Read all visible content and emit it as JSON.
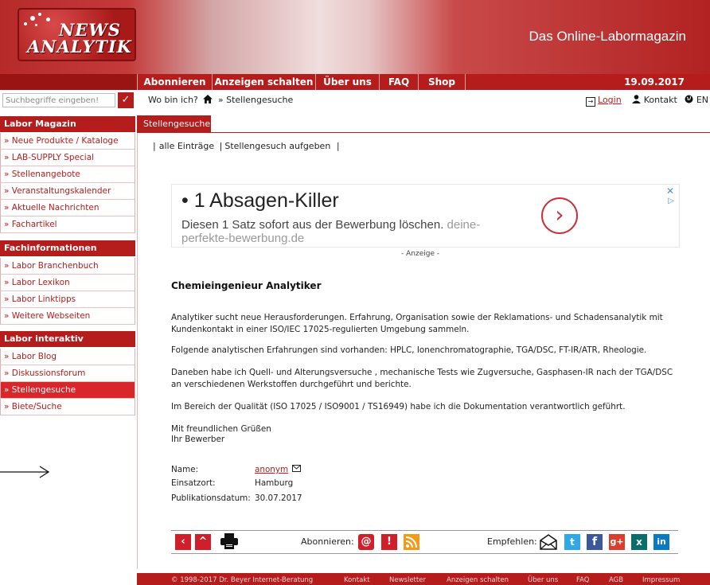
{
  "header": {
    "logo_top": "NEWS",
    "logo_bottom": "ANALYTIK",
    "magazine_title": "Das Online-Labormagazin"
  },
  "nav": {
    "items": [
      "Abonnieren",
      "Anzeigen schalten",
      "Über uns",
      "FAQ",
      "Shop"
    ],
    "date": "19.09.2017"
  },
  "search": {
    "placeholder": "Suchbegriffe eingeben!",
    "button_icon": "check-icon"
  },
  "breadcrumb": {
    "prefix": "Wo bin ich?",
    "current": "» Stellengesuche"
  },
  "topright": {
    "login": "Login",
    "kontakt": "Kontakt",
    "lang": "EN"
  },
  "sidebar": {
    "sections": [
      {
        "title": "Labor Magazin",
        "items": [
          "» Neue Produkte / Kataloge",
          "» LAB-SUPPLY Special",
          "» Stellenangebote",
          "» Veranstaltungskalender",
          "» Aktuelle Nachrichten",
          "» Fachartikel"
        ]
      },
      {
        "title": "Fachinformationen",
        "items": [
          "» Labor Branchenbuch",
          "» Labor Lexikon",
          "» Labor Linktipps",
          "» Weitere Webseiten"
        ]
      },
      {
        "title": "Labor interaktiv",
        "items": [
          "» Labor Blog",
          "» Diskussionsforum",
          "» Stellengesuche",
          "» Biete/Suche"
        ]
      }
    ],
    "active_item": "» Stellengesuche"
  },
  "content": {
    "tab": "Stellengesuche",
    "subnav": [
      "alle Einträge",
      "Stellengesuch aufgeben"
    ],
    "ad": {
      "title": "• 1 Absagen-Killer",
      "text": "Diesen 1 Satz sofort aus der Bewerbung löschen.",
      "domain": "deine-perfekte-bewerbung.de",
      "label": "- Anzeige -"
    },
    "job_title": "Chemieingenieur Analytiker",
    "paragraphs": [
      "Analytiker sucht neue Herausforderungen. Erfahrung, Organisation sowie der Reklamations- und Schadensanalytik mit Kundenkontakt in einer ISO/IEC 17025-regulierten Umgebung sammeln.",
      "Folgende analytischen Erfahrungen sind vorhanden: HPLC, Ionenchromatographie, TGA/DSC, FT-IR/ATR, Rheologie.",
      "Daneben habe ich Quell- und Alterungsversuche , mechanische Tests wie Zugversuche, Gasphasen-IR nach der TGA/DSC an verschiedenen Werkstoffen durchgeführt und berichte.",
      "Im Bereich der Qualität (ISO 17025 / ISO9001 / TS16949) habe ich die Dokumentation verantwortlich geführt."
    ],
    "greeting_1": "Mit freundlichen Grüßen",
    "greeting_2": "Ihr Bewerber",
    "meta": {
      "name_label": "Name:",
      "name_value": "anonym",
      "ort_label": "Einsatzort:",
      "ort_value": "Hamburg",
      "date_label": "Publikationsdatum:",
      "date_value": "30.07.2017"
    }
  },
  "toolbar": {
    "abonnieren": "Abonnieren:",
    "empfehlen": "Empfehlen:"
  },
  "footer": {
    "copyright": "© 1998-2017  Dr. Beyer Internet-Beratung",
    "links": [
      "Kontakt",
      "Newsletter",
      "Anzeigen schalten",
      "Über uns",
      "FAQ",
      "AGB",
      "Impressum"
    ]
  },
  "colors": {
    "brand_red": "#b51c1c",
    "active_red": "#d9262b"
  }
}
